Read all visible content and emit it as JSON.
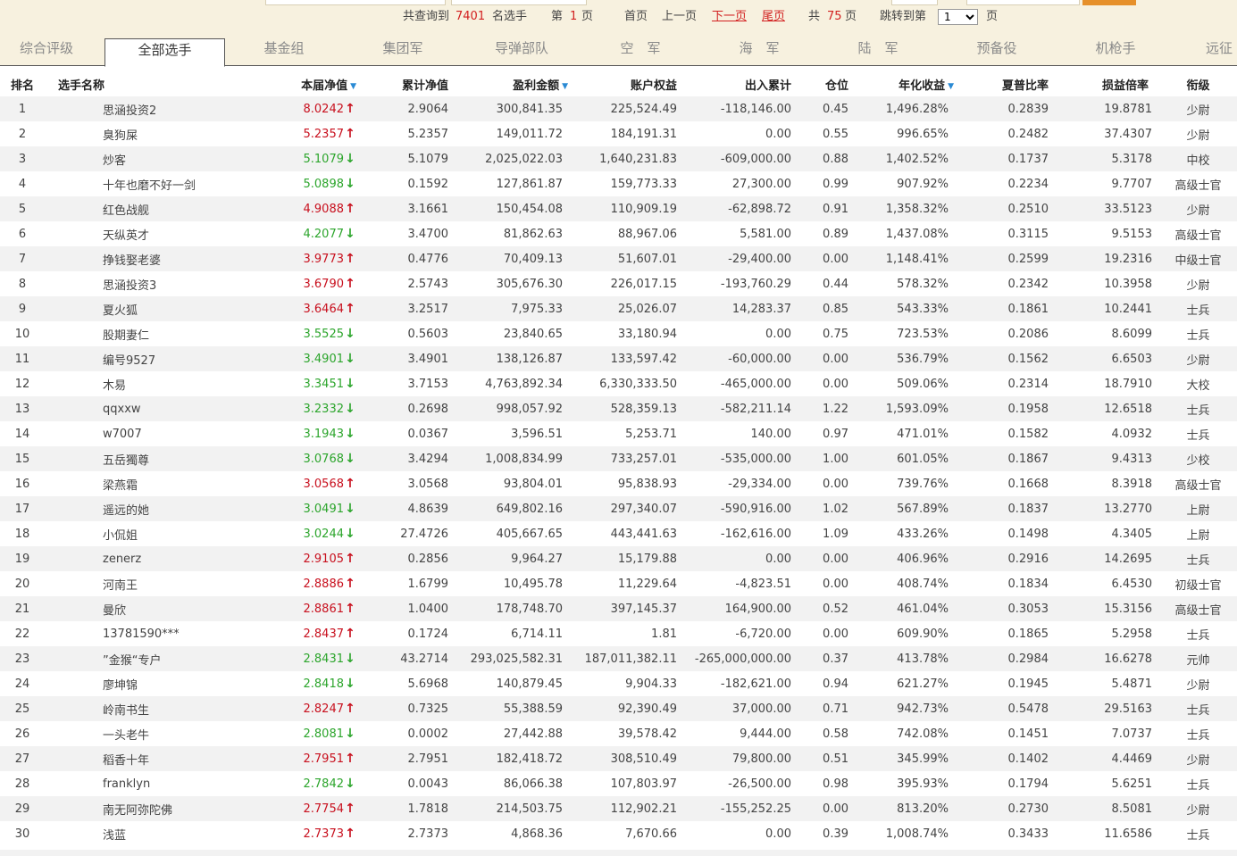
{
  "pager": {
    "total_prefix": "共查询到",
    "total_count": "7401",
    "total_suffix": "名选手",
    "page_prefix": "第",
    "current_page": "1",
    "page_suffix": "页",
    "first": "首页",
    "prev": "上一页",
    "next": "下一页",
    "last": "尾页",
    "pages_prefix": "共",
    "total_pages": "75",
    "pages_suffix": "页",
    "jump_label": "跳转到第",
    "jump_value": "1",
    "jump_suffix": "页"
  },
  "tabs": [
    "综合评级",
    "全部选手",
    "基金组",
    "集团军",
    "导弹部队",
    "空　军",
    "海　军",
    "陆　军",
    "预备役",
    "机枪手",
    "远征"
  ],
  "active_tab": "全部选手",
  "columns": [
    "排名",
    "选手名称",
    "本届净值",
    "累计净值",
    "盈利金额",
    "账户权益",
    "出入累计",
    "仓位",
    "年化收益",
    "夏普比率",
    "损益倍率",
    "衔级"
  ],
  "sorted_columns": [
    "本届净值",
    "盈利金额",
    "年化收益"
  ],
  "rows": [
    {
      "rank": "1",
      "name": "思涵投资2",
      "nv": "8.0242",
      "dir": "up",
      "cum": "2.9064",
      "profit": "300,841.35",
      "equity": "225,524.49",
      "flow": "-118,146.00",
      "pos": "0.45",
      "annual": "1,496.28%",
      "sharpe": "0.2839",
      "pl": "19.8781",
      "title": "少尉"
    },
    {
      "rank": "2",
      "name": "臭狗屎",
      "nv": "5.2357",
      "dir": "up",
      "cum": "5.2357",
      "profit": "149,011.72",
      "equity": "184,191.31",
      "flow": "0.00",
      "pos": "0.55",
      "annual": "996.65%",
      "sharpe": "0.2482",
      "pl": "37.4307",
      "title": "少尉"
    },
    {
      "rank": "3",
      "name": "炒客",
      "nv": "5.1079",
      "dir": "down",
      "cum": "5.1079",
      "profit": "2,025,022.03",
      "equity": "1,640,231.83",
      "flow": "-609,000.00",
      "pos": "0.88",
      "annual": "1,402.52%",
      "sharpe": "0.1737",
      "pl": "5.3178",
      "title": "中校"
    },
    {
      "rank": "4",
      "name": "十年也磨不好一剑",
      "nv": "5.0898",
      "dir": "down",
      "cum": "0.1592",
      "profit": "127,861.87",
      "equity": "159,773.33",
      "flow": "27,300.00",
      "pos": "0.99",
      "annual": "907.92%",
      "sharpe": "0.2234",
      "pl": "9.7707",
      "title": "高级士官"
    },
    {
      "rank": "5",
      "name": "红色战舰",
      "nv": "4.9088",
      "dir": "up",
      "cum": "3.1661",
      "profit": "150,454.08",
      "equity": "110,909.19",
      "flow": "-62,898.72",
      "pos": "0.91",
      "annual": "1,358.32%",
      "sharpe": "0.2510",
      "pl": "33.5123",
      "title": "少尉"
    },
    {
      "rank": "6",
      "name": "天纵英才",
      "nv": "4.2077",
      "dir": "down",
      "cum": "3.4700",
      "profit": "81,862.63",
      "equity": "88,967.06",
      "flow": "5,581.00",
      "pos": "0.89",
      "annual": "1,437.08%",
      "sharpe": "0.3115",
      "pl": "9.5153",
      "title": "高级士官"
    },
    {
      "rank": "7",
      "name": "挣钱娶老婆",
      "nv": "3.9773",
      "dir": "up",
      "cum": "0.4776",
      "profit": "70,409.13",
      "equity": "51,607.01",
      "flow": "-29,400.00",
      "pos": "0.00",
      "annual": "1,148.41%",
      "sharpe": "0.2599",
      "pl": "19.2316",
      "title": "中级士官"
    },
    {
      "rank": "8",
      "name": "思涵投资3",
      "nv": "3.6790",
      "dir": "up",
      "cum": "2.5743",
      "profit": "305,676.30",
      "equity": "226,017.15",
      "flow": "-193,760.29",
      "pos": "0.44",
      "annual": "578.32%",
      "sharpe": "0.2342",
      "pl": "10.3958",
      "title": "少尉"
    },
    {
      "rank": "9",
      "name": "夏火狐",
      "nv": "3.6464",
      "dir": "up",
      "cum": "3.2517",
      "profit": "7,975.33",
      "equity": "25,026.07",
      "flow": "14,283.37",
      "pos": "0.85",
      "annual": "543.33%",
      "sharpe": "0.1861",
      "pl": "10.2441",
      "title": "士兵"
    },
    {
      "rank": "10",
      "name": "股期妻仁",
      "nv": "3.5525",
      "dir": "down",
      "cum": "0.5603",
      "profit": "23,840.65",
      "equity": "33,180.94",
      "flow": "0.00",
      "pos": "0.75",
      "annual": "723.53%",
      "sharpe": "0.2086",
      "pl": "8.6099",
      "title": "士兵"
    },
    {
      "rank": "11",
      "name": "编号9527",
      "nv": "3.4901",
      "dir": "down",
      "cum": "3.4901",
      "profit": "138,126.87",
      "equity": "133,597.42",
      "flow": "-60,000.00",
      "pos": "0.00",
      "annual": "536.79%",
      "sharpe": "0.1562",
      "pl": "6.6503",
      "title": "少尉"
    },
    {
      "rank": "12",
      "name": "木易",
      "nv": "3.3451",
      "dir": "down",
      "cum": "3.7153",
      "profit": "4,763,892.34",
      "equity": "6,330,333.50",
      "flow": "-465,000.00",
      "pos": "0.00",
      "annual": "509.06%",
      "sharpe": "0.2314",
      "pl": "18.7910",
      "title": "大校"
    },
    {
      "rank": "13",
      "name": "qqxxw",
      "nv": "3.2332",
      "dir": "down",
      "cum": "0.2698",
      "profit": "998,057.92",
      "equity": "528,359.13",
      "flow": "-582,211.14",
      "pos": "1.22",
      "annual": "1,593.09%",
      "sharpe": "0.1958",
      "pl": "12.6518",
      "title": "士兵"
    },
    {
      "rank": "14",
      "name": "w7007",
      "nv": "3.1943",
      "dir": "down",
      "cum": "0.0367",
      "profit": "3,596.51",
      "equity": "5,253.71",
      "flow": "140.00",
      "pos": "0.97",
      "annual": "471.01%",
      "sharpe": "0.1582",
      "pl": "4.0932",
      "title": "士兵"
    },
    {
      "rank": "15",
      "name": "五岳獨尊",
      "nv": "3.0768",
      "dir": "down",
      "cum": "3.4294",
      "profit": "1,008,834.99",
      "equity": "733,257.01",
      "flow": "-535,000.00",
      "pos": "1.00",
      "annual": "601.05%",
      "sharpe": "0.1867",
      "pl": "9.4313",
      "title": "少校"
    },
    {
      "rank": "16",
      "name": "梁燕霜",
      "nv": "3.0568",
      "dir": "up",
      "cum": "3.0568",
      "profit": "93,804.01",
      "equity": "95,838.93",
      "flow": "-29,334.00",
      "pos": "0.00",
      "annual": "739.76%",
      "sharpe": "0.1668",
      "pl": "8.3918",
      "title": "高级士官"
    },
    {
      "rank": "17",
      "name": "遥远的她",
      "nv": "3.0491",
      "dir": "down",
      "cum": "4.8639",
      "profit": "649,802.16",
      "equity": "297,340.07",
      "flow": "-590,916.00",
      "pos": "1.02",
      "annual": "567.89%",
      "sharpe": "0.1837",
      "pl": "13.2770",
      "title": "上尉"
    },
    {
      "rank": "18",
      "name": "小侃姐",
      "nv": "3.0244",
      "dir": "down",
      "cum": "27.4726",
      "profit": "405,667.65",
      "equity": "443,441.63",
      "flow": "-162,616.00",
      "pos": "1.09",
      "annual": "433.26%",
      "sharpe": "0.1498",
      "pl": "4.3405",
      "title": "上尉"
    },
    {
      "rank": "19",
      "name": "zenerz",
      "nv": "2.9105",
      "dir": "up",
      "cum": "0.2856",
      "profit": "9,964.27",
      "equity": "15,179.88",
      "flow": "0.00",
      "pos": "0.00",
      "annual": "406.96%",
      "sharpe": "0.2916",
      "pl": "14.2695",
      "title": "士兵"
    },
    {
      "rank": "20",
      "name": "河南王",
      "nv": "2.8886",
      "dir": "up",
      "cum": "1.6799",
      "profit": "10,495.78",
      "equity": "11,229.64",
      "flow": "-4,823.51",
      "pos": "0.00",
      "annual": "408.74%",
      "sharpe": "0.1834",
      "pl": "6.4530",
      "title": "初级士官"
    },
    {
      "rank": "21",
      "name": "曼欣",
      "nv": "2.8861",
      "dir": "up",
      "cum": "1.0400",
      "profit": "178,748.70",
      "equity": "397,145.37",
      "flow": "164,900.00",
      "pos": "0.52",
      "annual": "461.04%",
      "sharpe": "0.3053",
      "pl": "15.3156",
      "title": "高级士官"
    },
    {
      "rank": "22",
      "name": "13781590***",
      "nv": "2.8437",
      "dir": "up",
      "cum": "0.1724",
      "profit": "6,714.11",
      "equity": "1.81",
      "flow": "-6,720.00",
      "pos": "0.00",
      "annual": "609.90%",
      "sharpe": "0.1865",
      "pl": "5.2958",
      "title": "士兵"
    },
    {
      "rank": "23",
      "name": "”金猴“专户",
      "nv": "2.8431",
      "dir": "down",
      "cum": "43.2714",
      "profit": "293,025,582.31",
      "equity": "187,011,382.11",
      "flow": "-265,000,000.00",
      "pos": "0.37",
      "annual": "413.78%",
      "sharpe": "0.2984",
      "pl": "16.6278",
      "title": "元帅"
    },
    {
      "rank": "24",
      "name": "廖坤锦",
      "nv": "2.8418",
      "dir": "down",
      "cum": "5.6968",
      "profit": "140,879.45",
      "equity": "9,904.33",
      "flow": "-182,621.00",
      "pos": "0.94",
      "annual": "621.27%",
      "sharpe": "0.1945",
      "pl": "5.4871",
      "title": "少尉"
    },
    {
      "rank": "25",
      "name": "岭南书生",
      "nv": "2.8247",
      "dir": "up",
      "cum": "0.7325",
      "profit": "55,388.59",
      "equity": "92,390.49",
      "flow": "37,000.00",
      "pos": "0.71",
      "annual": "942.73%",
      "sharpe": "0.5478",
      "pl": "29.5163",
      "title": "士兵"
    },
    {
      "rank": "26",
      "name": "一头老牛",
      "nv": "2.8081",
      "dir": "down",
      "cum": "0.0002",
      "profit": "27,442.88",
      "equity": "39,578.42",
      "flow": "9,444.00",
      "pos": "0.58",
      "annual": "742.08%",
      "sharpe": "0.1451",
      "pl": "7.0737",
      "title": "士兵"
    },
    {
      "rank": "27",
      "name": "稻香十年",
      "nv": "2.7951",
      "dir": "up",
      "cum": "2.7951",
      "profit": "182,418.72",
      "equity": "308,510.49",
      "flow": "79,800.00",
      "pos": "0.51",
      "annual": "345.99%",
      "sharpe": "0.1402",
      "pl": "4.4469",
      "title": "少尉"
    },
    {
      "rank": "28",
      "name": "franklyn",
      "nv": "2.7842",
      "dir": "down",
      "cum": "0.0043",
      "profit": "86,066.38",
      "equity": "107,803.97",
      "flow": "-26,500.00",
      "pos": "0.98",
      "annual": "395.93%",
      "sharpe": "0.1794",
      "pl": "5.6251",
      "title": "士兵"
    },
    {
      "rank": "29",
      "name": "南无阿弥陀佛",
      "nv": "2.7754",
      "dir": "up",
      "cum": "1.7818",
      "profit": "214,503.75",
      "equity": "112,902.21",
      "flow": "-155,252.25",
      "pos": "0.00",
      "annual": "813.20%",
      "sharpe": "0.2730",
      "pl": "8.5081",
      "title": "少尉"
    },
    {
      "rank": "30",
      "name": "浅蓝",
      "nv": "2.7373",
      "dir": "up",
      "cum": "2.7373",
      "profit": "4,868.36",
      "equity": "7,670.66",
      "flow": "0.00",
      "pos": "0.39",
      "annual": "1,008.74%",
      "sharpe": "0.3433",
      "pl": "11.6586",
      "title": "士兵"
    }
  ],
  "colors": {
    "up": "#c8101e",
    "down": "#2ca52c",
    "topbar": "#f7f1df",
    "accent": "#e6902a"
  },
  "icons": {
    "up": "arrow-up-icon",
    "down": "arrow-down-icon",
    "sort": "sort-desc-icon"
  }
}
